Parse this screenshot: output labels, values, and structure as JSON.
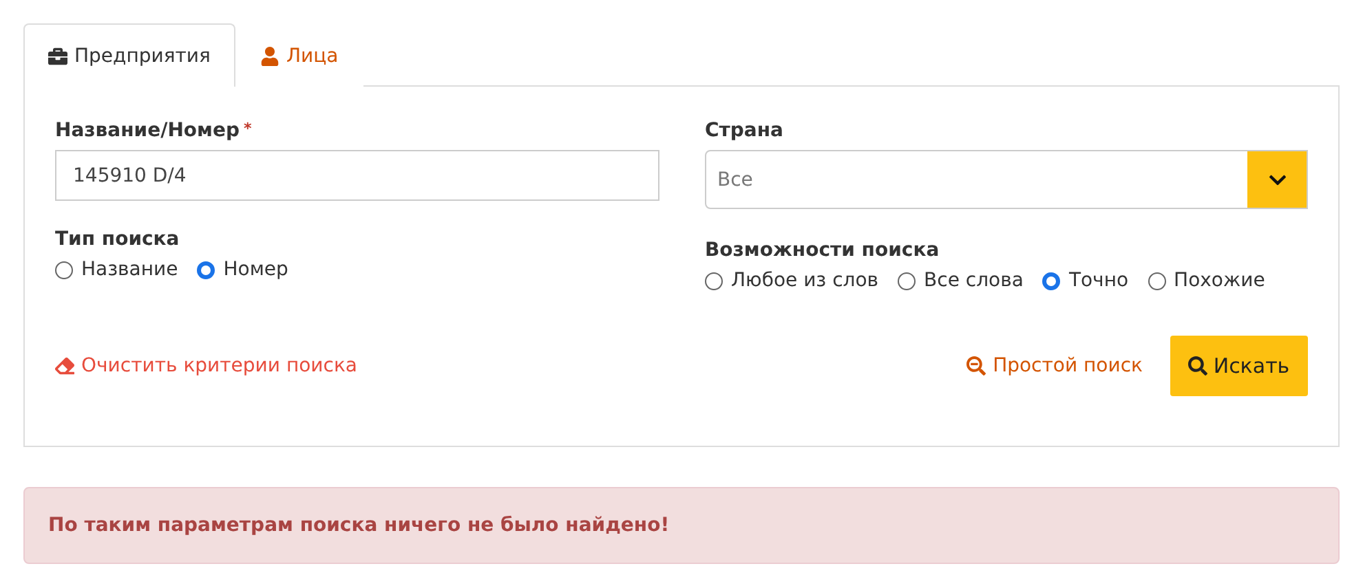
{
  "tabs": [
    {
      "label": "Предприятия",
      "kind": "briefcase",
      "selected": true
    },
    {
      "label": "Лица",
      "kind": "user",
      "selected": false
    }
  ],
  "form": {
    "name_field": {
      "label": "Название/Номер",
      "required_mark": "*",
      "value": "145910 D/4"
    },
    "search_type": {
      "label": "Тип поиска",
      "options": [
        {
          "label": "Название",
          "selected": false
        },
        {
          "label": "Номер",
          "selected": true
        }
      ]
    },
    "country": {
      "label": "Страна",
      "value": "Все"
    },
    "search_options": {
      "label": "Возможности поиска",
      "options": [
        {
          "label": "Любое из слов",
          "selected": false
        },
        {
          "label": "Все слова",
          "selected": false
        },
        {
          "label": "Точно",
          "selected": true
        },
        {
          "label": "Похожие",
          "selected": false
        }
      ]
    },
    "clear_link": "Очистить критерии поиска",
    "simple_search_link": "Простой поиск",
    "search_button": "Искать"
  },
  "alert": "По таким параметрам поиска ничего не было найдено!"
}
